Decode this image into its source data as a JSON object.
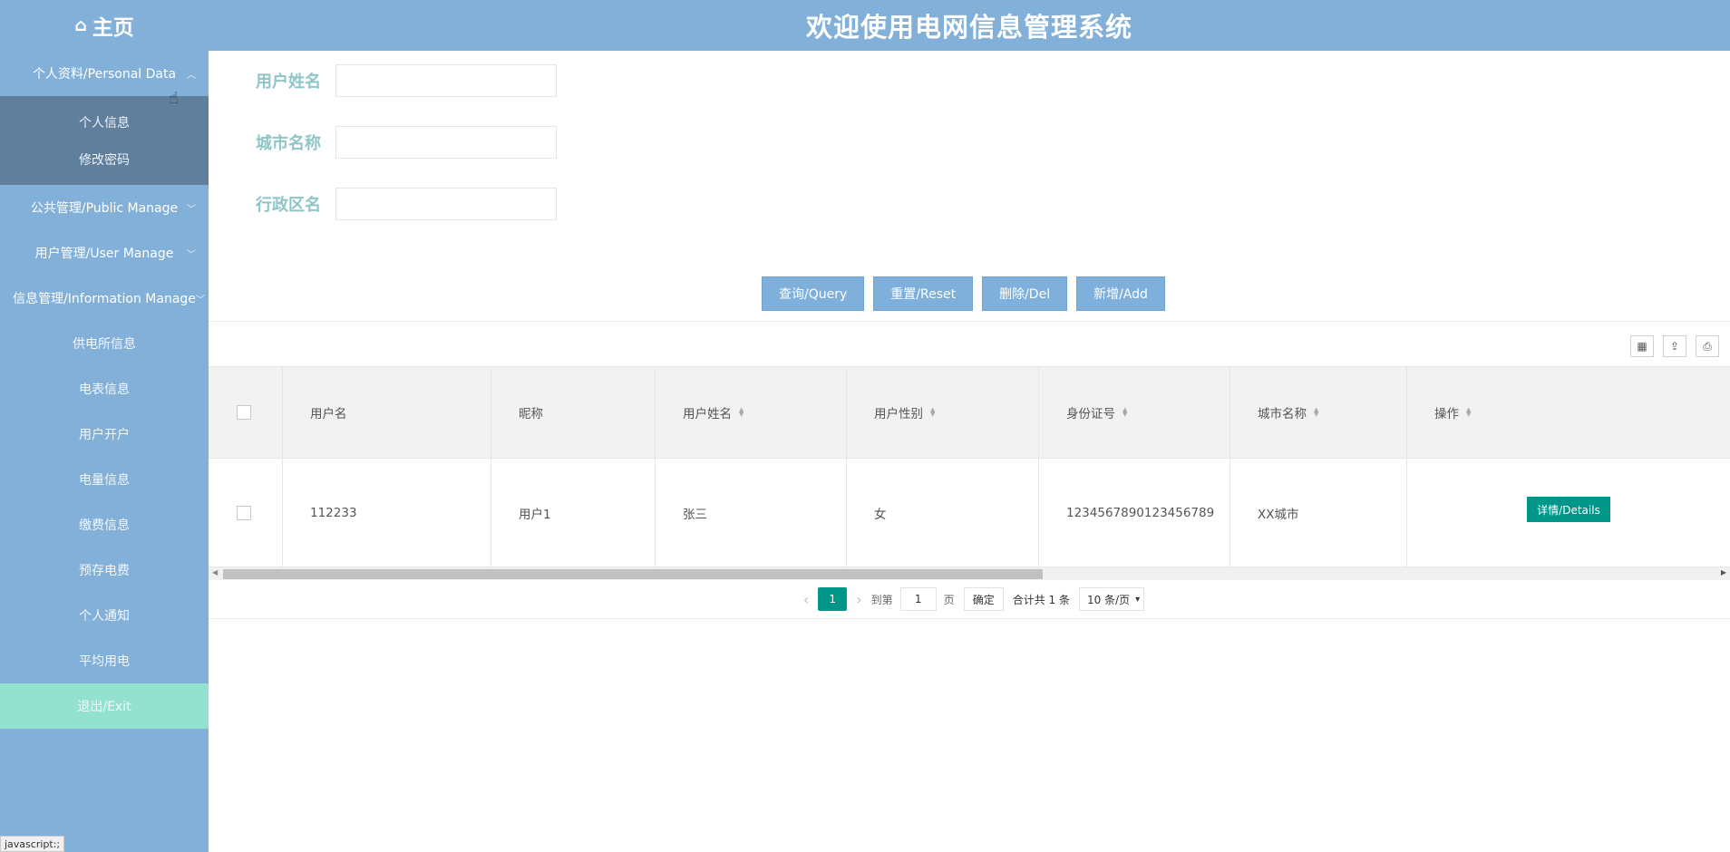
{
  "header": {
    "home_label": "主页",
    "home_icon": "home-icon",
    "title": "欢迎使用电网信息管理系统"
  },
  "sidebar": {
    "groups": [
      {
        "label": "个人资料/Personal Data",
        "expanded": true,
        "children": [
          "个人信息",
          "修改密码"
        ]
      },
      {
        "label": "公共管理/Public Manage",
        "expanded": false
      },
      {
        "label": "用户管理/User Manage",
        "expanded": false
      },
      {
        "label": "信息管理/Information Manage",
        "expanded": false
      }
    ],
    "items": [
      "供电所信息",
      "电表信息",
      "用户开户",
      "电量信息",
      "缴费信息",
      "预存电费",
      "个人通知",
      "平均用电"
    ],
    "exit_label": "退出/Exit"
  },
  "search": {
    "fields": [
      {
        "label": "用户姓名",
        "value": ""
      },
      {
        "label": "城市名称",
        "value": ""
      },
      {
        "label": "行政区名",
        "value": ""
      }
    ]
  },
  "actions": {
    "query": "查询/Query",
    "reset": "重置/Reset",
    "delete": "删除/Del",
    "add": "新增/Add"
  },
  "table": {
    "columns": [
      "用户名",
      "昵称",
      "用户姓名",
      "用户性别",
      "身份证号",
      "城市名称",
      "操作"
    ],
    "rows": [
      {
        "username": "112233",
        "nickname": "用户1",
        "realname": "张三",
        "gender": "女",
        "idcard": "1234567890123456789",
        "city": "XX城市",
        "action": "详情/Details"
      }
    ]
  },
  "pagination": {
    "current_page": "1",
    "goto_label": "到第",
    "goto_value": "1",
    "page_unit": "页",
    "confirm": "确定",
    "total": "合计共 1 条",
    "page_size": "10 条/页"
  },
  "statusbar": {
    "text": "javascript:;"
  },
  "colors": {
    "primary": "#82b0d8",
    "accent": "#009688",
    "exit": "#93e1cf",
    "label": "#8fc5c8"
  }
}
